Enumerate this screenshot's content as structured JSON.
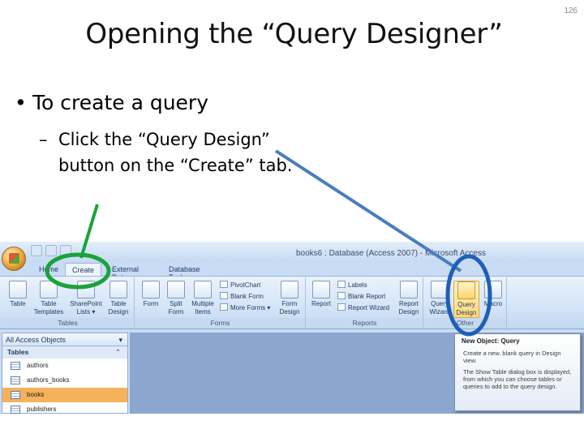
{
  "slide": {
    "number": "126",
    "title": "Opening the “Query Designer”",
    "bullet_1": "To create a query",
    "bullet_1_marker": "•",
    "bullet_2_marker": "–",
    "bullet_2": "Click the “Query Design” button on the “Create” tab."
  },
  "annotation_colors": {
    "create_tab_circle": "#1aa33a",
    "query_design_circle": "#1e5fb8",
    "arrow": "#4a7dbe"
  },
  "access_window": {
    "title": "books6 : Database (Access 2007) - Microsoft Access",
    "tabs": [
      {
        "label": "Home"
      },
      {
        "label": "Create",
        "active": true
      },
      {
        "label": "External Data"
      },
      {
        "label": "Database Tools"
      }
    ],
    "ribbon": {
      "groups": [
        "Tables",
        "Forms",
        "Reports",
        "Other"
      ],
      "tables_buttons": [
        "Table",
        "Table Templates ▾",
        "SharePoint Lists ▾",
        "Table Design"
      ],
      "forms_buttons": [
        "Form",
        "Split Form",
        "Multiple Items",
        "Form Design"
      ],
      "forms_small": [
        "PivotChart",
        "Blank Form",
        "More Forms ▾"
      ],
      "reports_buttons": [
        "Report",
        "Report Design"
      ],
      "reports_small": [
        "Labels",
        "Blank Report",
        "Report Wizard"
      ],
      "other_buttons": [
        "Query Wizard",
        "Query Design",
        "Macro"
      ]
    },
    "nav_pane": {
      "header": "All Access Objects",
      "header_icon": "chevron-down-icon",
      "section": "Tables",
      "section_icon": "collapse-icon",
      "items": [
        "authors",
        "authors_books",
        "books",
        "publishers"
      ],
      "selected": "books"
    },
    "tooltip": {
      "title": "New Object: Query",
      "line_1": "Create a new, blank query in Design view.",
      "line_2": "The Show Table dialog box is displayed, from which you can choose tables or queries to add to the query design."
    }
  }
}
